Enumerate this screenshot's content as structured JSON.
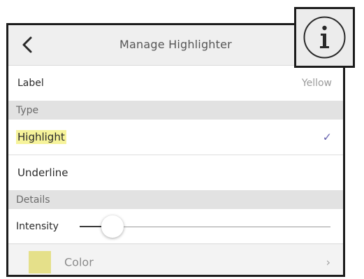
{
  "navbar": {
    "title": "Manage Highlighter",
    "back_icon": "chevron-left-icon"
  },
  "label_row": {
    "label": "Label",
    "value": "Yellow"
  },
  "type_section": {
    "header": "Type",
    "options": [
      {
        "label": "Highlight",
        "selected": true
      },
      {
        "label": "Underline",
        "selected": false
      }
    ],
    "check_glyph": "✓"
  },
  "details_section": {
    "header": "Details",
    "intensity_label": "Intensity",
    "intensity_level": 0.13,
    "color_label": "Color",
    "color_swatch": "#e5e08a",
    "chevron_glyph": "›"
  },
  "info_button": {
    "icon": "info-icon"
  },
  "colors": {
    "highlight": "#f6f39a",
    "checkmark": "#6a66b0"
  }
}
